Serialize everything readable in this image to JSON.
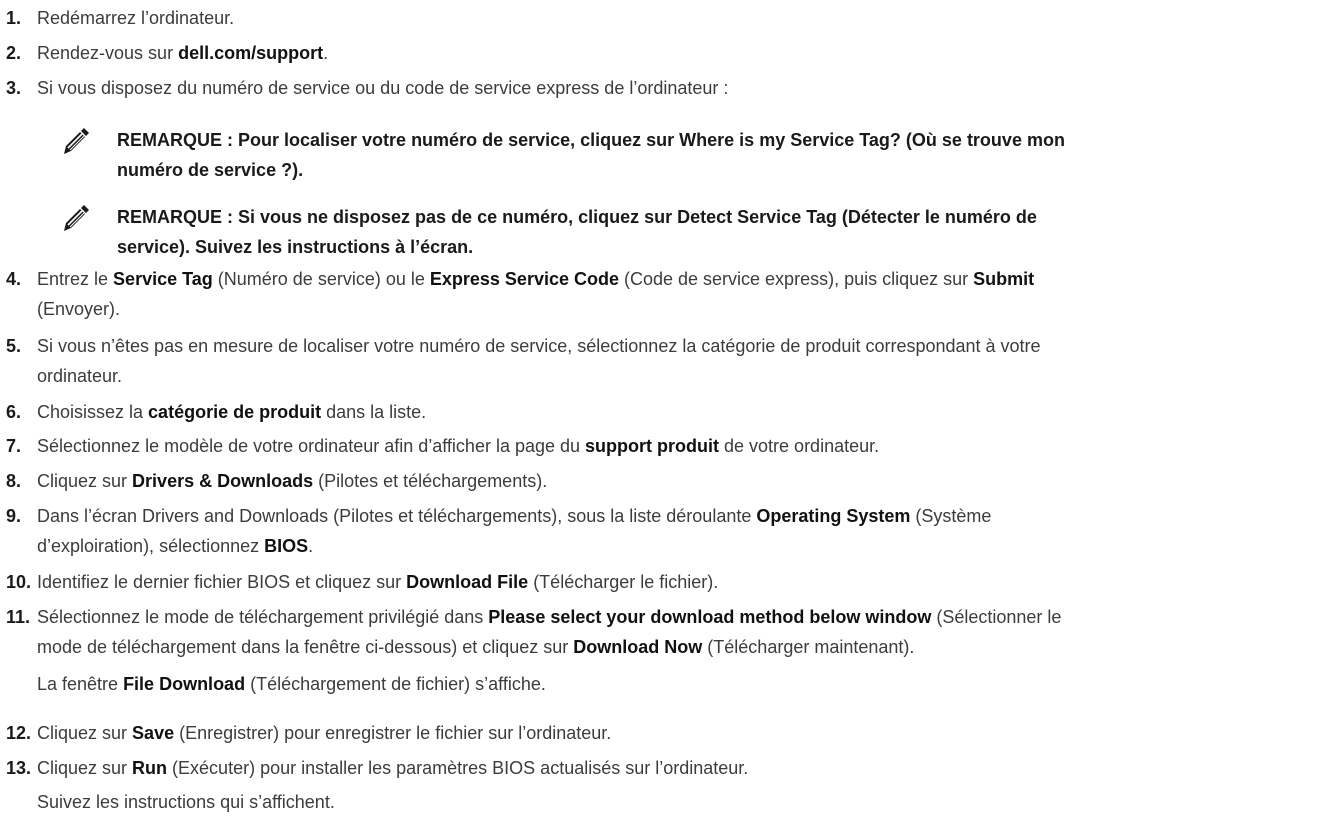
{
  "steps": {
    "s1": {
      "num": "1.",
      "text": "Redémarrez l’ordinateur."
    },
    "s2": {
      "num": "2.",
      "pre": "Rendez-vous sur ",
      "bold": "dell.com/support",
      "post": "."
    },
    "s3": {
      "num": "3.",
      "text": "Si vous disposez du numéro de service ou du code de service express de l’ordinateur :"
    },
    "s4": {
      "num": "4.",
      "a": "Entrez le ",
      "b1": "Service Tag",
      "c": " (Numéro de service) ou le ",
      "b2": "Express Service Code",
      "d": " (Code de service express), puis cliquez sur ",
      "b3": "Submit",
      "line2": "(Envoyer)."
    },
    "s5": {
      "num": "5.",
      "line1": "Si vous n’êtes pas en mesure de localiser votre numéro de service, sélectionnez la catégorie de produit correspondant à votre",
      "line2": "ordinateur."
    },
    "s6": {
      "num": "6.",
      "a": "Choisissez la ",
      "b1": "catégorie de produit",
      "c": " dans la liste."
    },
    "s7": {
      "num": "7.",
      "a": "Sélectionnez le modèle de votre ordinateur afin d’afficher la page du ",
      "b1": "support produit",
      "c": " de votre ordinateur."
    },
    "s8": {
      "num": "8.",
      "a": "Cliquez sur ",
      "b1": "Drivers & Downloads",
      "c": " (Pilotes et téléchargements)."
    },
    "s9": {
      "num": "9.",
      "a": "Dans l’écran Drivers and Downloads (Pilotes et téléchargements), sous la liste déroulante ",
      "b1": "Operating System",
      "c": " (Système",
      "line2a": "d’exploiration), sélectionnez ",
      "b2": "BIOS",
      "line2c": "."
    },
    "s10": {
      "num": "10.",
      "a": "Identifiez le dernier fichier BIOS et cliquez sur ",
      "b1": "Download File",
      "c": " (Télécharger le fichier)."
    },
    "s11": {
      "num": "11.",
      "a": "Sélectionnez le mode de téléchargement privilégié dans ",
      "b1": "Please select your download method below window",
      "c": " (Sélectionner le",
      "line2a": "mode de téléchargement dans la fenêtre ci-dessous) et cliquez sur ",
      "b2": "Download Now",
      "line2c": " (Télécharger maintenant).",
      "sub_a": "La fenêtre ",
      "sub_b": "File Download",
      "sub_c": " (Téléchargement de fichier) s’affiche."
    },
    "s12": {
      "num": "12.",
      "a": "Cliquez sur ",
      "b1": "Save",
      "c": " (Enregistrer) pour enregistrer le fichier sur l’ordinateur."
    },
    "s13": {
      "num": "13.",
      "a": "Cliquez sur ",
      "b1": "Run",
      "c": " (Exécuter) pour installer les paramètres BIOS actualisés sur l’ordinateur.",
      "sub": "Suivez les instructions qui s’affichent."
    }
  },
  "notes": [
    {
      "line1": "REMARQUE : Pour localiser votre numéro de service, cliquez sur Where is my Service Tag? (Où se trouve mon",
      "line2": "numéro de service ?)."
    },
    {
      "line1": "REMARQUE : Si vous ne disposez pas de ce numéro, cliquez sur Detect Service Tag (Détecter le numéro de",
      "line2": "service). Suivez les instructions à l’écran."
    }
  ],
  "icons": {
    "note": "note-pencil-icon"
  }
}
